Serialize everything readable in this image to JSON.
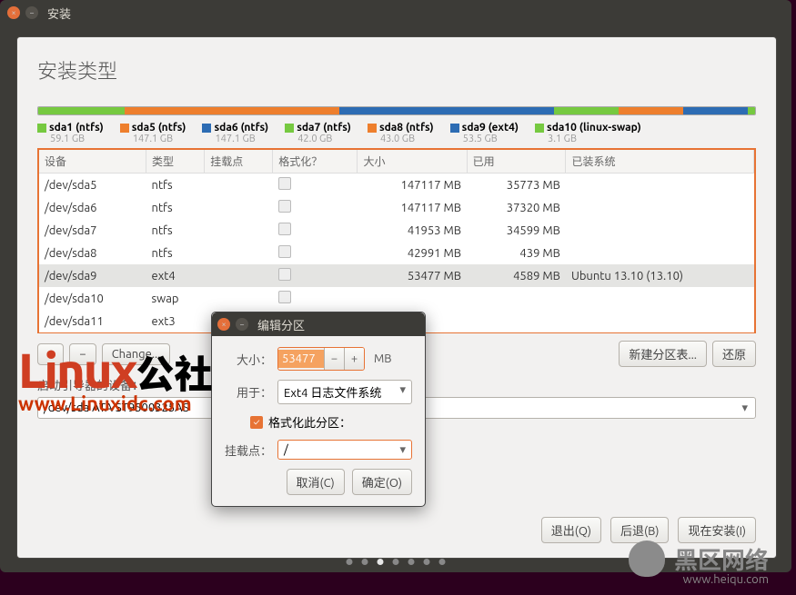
{
  "window": {
    "title": "安装"
  },
  "page_title": "安装类型",
  "bar_segments": [
    {
      "color": "#76c940",
      "w": 12
    },
    {
      "color": "#ee7f2d",
      "w": 30
    },
    {
      "color": "#2d6cb3",
      "w": 30
    },
    {
      "color": "#76c940",
      "w": 9
    },
    {
      "color": "#ee7f2d",
      "w": 9
    },
    {
      "color": "#2d6cb3",
      "w": 9
    },
    {
      "color": "#76c940",
      "w": 1
    }
  ],
  "legend": [
    {
      "color": "#76c940",
      "name": "sda1 (ntfs)",
      "size": "59.1 GB"
    },
    {
      "color": "#ee7f2d",
      "name": "sda5 (ntfs)",
      "size": "147.1 GB"
    },
    {
      "color": "#2d6cb3",
      "name": "sda6 (ntfs)",
      "size": "147.1 GB"
    },
    {
      "color": "#76c940",
      "name": "sda7 (ntfs)",
      "size": "42.0 GB"
    },
    {
      "color": "#ee7f2d",
      "name": "sda8 (ntfs)",
      "size": "43.0 GB"
    },
    {
      "color": "#2d6cb3",
      "name": "sda9 (ext4)",
      "size": "53.5 GB"
    },
    {
      "color": "#76c940",
      "name": "sda10 (linux-swap)",
      "size": "3.1 GB"
    }
  ],
  "columns": {
    "device": "设备",
    "type": "类型",
    "mount": "挂载点",
    "format": "格式化？",
    "size": "大小",
    "used": "已用",
    "system": "已装系统"
  },
  "rows": [
    {
      "device": "/dev/sda5",
      "type": "ntfs",
      "mount": "",
      "format": false,
      "size": "147117 MB",
      "used": "35773 MB",
      "system": ""
    },
    {
      "device": "/dev/sda6",
      "type": "ntfs",
      "mount": "",
      "format": false,
      "size": "147117 MB",
      "used": "37320 MB",
      "system": ""
    },
    {
      "device": "/dev/sda7",
      "type": "ntfs",
      "mount": "",
      "format": false,
      "size": "41953 MB",
      "used": "34599 MB",
      "system": ""
    },
    {
      "device": "/dev/sda8",
      "type": "ntfs",
      "mount": "",
      "format": false,
      "size": "42991 MB",
      "used": "439 MB",
      "system": ""
    },
    {
      "device": "/dev/sda9",
      "type": "ext4",
      "mount": "",
      "format": false,
      "size": "53477 MB",
      "used": "4589 MB",
      "system": "Ubuntu 13.10 (13.10)",
      "selected": true
    },
    {
      "device": "/dev/sda10",
      "type": "swap",
      "mount": "",
      "format": false,
      "size": "",
      "used": "",
      "system": ""
    },
    {
      "device": "/dev/sda11",
      "type": "ext3",
      "mount": "",
      "format": false,
      "size": "",
      "used": "",
      "system": ""
    }
  ],
  "buttons": {
    "plus": "+",
    "minus": "−",
    "change": "Change...",
    "new_table": "新建分区表...",
    "revert": "还原"
  },
  "boot_label": "启动引导器的设备：",
  "boot_value": "/dev/sda    ATA ST9500325AS",
  "nav": {
    "quit": "退出(Q)",
    "back": "后退(B)",
    "install": "现在安装(I)"
  },
  "dialog": {
    "title": "编辑分区",
    "size_label": "大小：",
    "size_value": "53477",
    "size_unit": "MB",
    "use_label": "用于：",
    "use_value": "Ext4 日志文件系统",
    "format_label": "格式化此分区：",
    "format_checked": true,
    "mount_label": "挂载点：",
    "mount_value": "/",
    "cancel": "取消(C)",
    "ok": "确定(O)"
  },
  "watermark": {
    "big1": "Linux",
    "big2": "公社",
    "url": "www.Linuxidc.com"
  },
  "bgwm": {
    "text": "黑区网络",
    "url": "www.heiqu.com"
  }
}
